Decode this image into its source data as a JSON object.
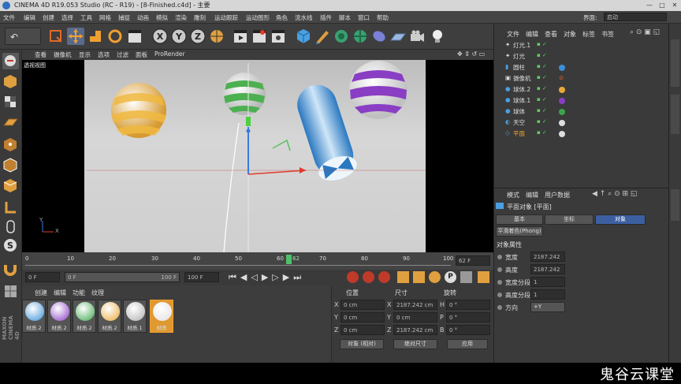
{
  "window": {
    "title": "CINEMA 4D R19.053 Studio (RC - R19) - [8-Finished.c4d] - 主要"
  },
  "menu": {
    "items": [
      "文件",
      "编辑",
      "创建",
      "选择",
      "工具",
      "网格",
      "捕捉",
      "动画",
      "模拟",
      "渲染",
      "雕刻",
      "运动跟踪",
      "运动图形",
      "角色",
      "流水线",
      "插件",
      "脚本",
      "窗口",
      "帮助"
    ],
    "layout_label": "界面:",
    "layout_value": "启动"
  },
  "viewport": {
    "menu": [
      "查看",
      "摄像机",
      "显示",
      "选项",
      "过滤",
      "面板",
      "ProRender"
    ],
    "label": "透视视图",
    "axis_y": "Y",
    "axis_x": "X"
  },
  "timeline": {
    "ticks": [
      "0",
      "10",
      "20",
      "30",
      "40",
      "50",
      "60",
      "62",
      "70",
      "80",
      "90",
      "100"
    ],
    "current_frame": 62,
    "end_field": "62 F"
  },
  "transport": {
    "start": "0 F",
    "range_start": "0 F",
    "range_end": "100 F",
    "end": "100 F"
  },
  "materials": {
    "menu": [
      "创建",
      "编辑",
      "功能",
      "纹理"
    ],
    "items": [
      {
        "label": "材质.2",
        "color": "#3a8fd6"
      },
      {
        "label": "材质.2",
        "color": "#8a3ec4"
      },
      {
        "label": "材质.2",
        "color": "#3aa64a"
      },
      {
        "label": "材质.2",
        "color": "#e8a93a"
      },
      {
        "label": "材质.1",
        "color": "#b0b0b0"
      },
      {
        "label": "材质",
        "color": "#e0e0e0"
      }
    ]
  },
  "coords": {
    "headers": [
      "位置",
      "尺寸",
      "旋转"
    ],
    "rows": [
      {
        "axis": "X",
        "pos": "0 cm",
        "size_axis": "X",
        "size": "2187.242 cm",
        "rot_axis": "H",
        "rot": "0 °"
      },
      {
        "axis": "Y",
        "pos": "0 cm",
        "size_axis": "Y",
        "size": "0 cm",
        "rot_axis": "P",
        "rot": "0 °"
      },
      {
        "axis": "Z",
        "pos": "0 cm",
        "size_axis": "Z",
        "size": "2187.242 cm",
        "rot_axis": "B",
        "rot": "0 °"
      }
    ],
    "mode": "对象 (相对)",
    "size_mode": "绝对尺寸",
    "apply": "应用"
  },
  "object_manager": {
    "menu": [
      "文件",
      "编辑",
      "查看",
      "对象",
      "标签",
      "书签"
    ],
    "objects": [
      {
        "name": "灯光.1",
        "selected": false
      },
      {
        "name": "灯光",
        "selected": false
      },
      {
        "name": "圆柱",
        "selected": false
      },
      {
        "name": "摄像机",
        "selected": false
      },
      {
        "name": "球体.2",
        "selected": false
      },
      {
        "name": "球体.1",
        "selected": false
      },
      {
        "name": "球体",
        "selected": false
      },
      {
        "name": "天空",
        "selected": false
      },
      {
        "name": "平面",
        "selected": true
      }
    ]
  },
  "attributes": {
    "menu": [
      "模式",
      "编辑",
      "用户数据"
    ],
    "object_title": "平面对象 [平面]",
    "tabs": [
      "基本",
      "坐标",
      "对象"
    ],
    "active_tab": "对象",
    "phong_tab": "平滑着色(Phong)",
    "section": "对象属性",
    "fields": [
      {
        "label": "宽度",
        "value": "2187.242"
      },
      {
        "label": "高度",
        "value": "2187.242"
      },
      {
        "label": "宽度分段",
        "value": "1"
      },
      {
        "label": "高度分段",
        "value": "1"
      },
      {
        "label": "方向",
        "value": "+Y"
      }
    ]
  },
  "watermark": "鬼谷云课堂",
  "colors": {
    "accent": "#3c5fa0",
    "ui_bg": "#3a3a3a",
    "timeline_marker": "#4fc06a"
  }
}
